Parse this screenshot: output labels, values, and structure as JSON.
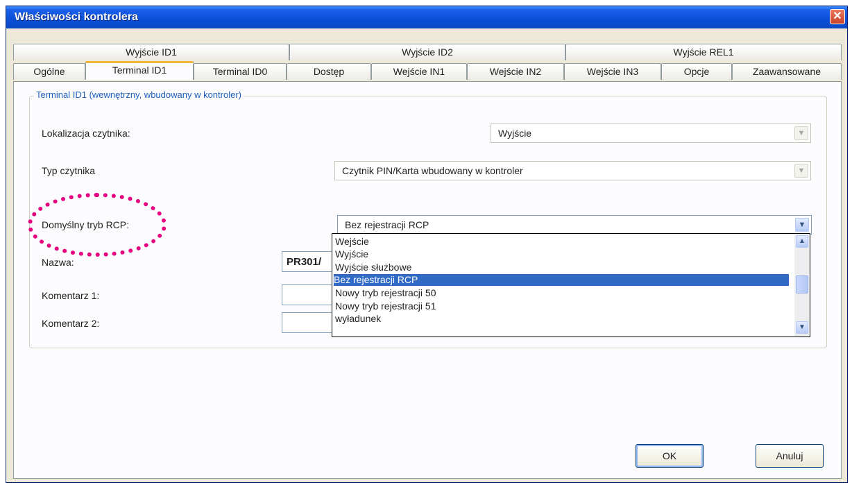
{
  "window": {
    "title": "Właściwości kontrolera",
    "close_symbol": "✕"
  },
  "tabs_top": [
    "Wyjście ID1",
    "Wyjście ID2",
    "Wyjście REL1"
  ],
  "tabs_bottom": [
    "Ogólne",
    "Terminal ID1",
    "Terminal ID0",
    "Dostęp",
    "Wejście IN1",
    "Wejście IN2",
    "Wejście IN3",
    "Opcje",
    "Zaawansowane"
  ],
  "active_tab": "Terminal ID1",
  "group": {
    "legend": "Terminal ID1 (wewnętrzny, wbudowany w kontroler)"
  },
  "fields": {
    "reader_location": {
      "label": "Lokalizacja czytnika:",
      "value": "Wyjście"
    },
    "reader_type": {
      "label": "Typ czytnika",
      "value": "Czytnik PIN/Karta wbudowany w kontroler"
    },
    "rcp_mode": {
      "label": "Domyślny tryb RCP:",
      "value": "Bez rejestracji RCP"
    },
    "name": {
      "label": "Nazwa:",
      "value": "PR301/"
    },
    "comment1": {
      "label": "Komentarz 1:",
      "value": ""
    },
    "comment2": {
      "label": "Komentarz 2:",
      "value": ""
    }
  },
  "dropdown": {
    "options": [
      "Wejście",
      "Wyjście",
      "Wyjście służbowe",
      "Bez rejestracji RCP",
      "Nowy tryb rejestracji 50",
      "Nowy tryb rejestracji 51",
      "wyładunek"
    ],
    "selected": "Bez rejestracji RCP"
  },
  "buttons": {
    "ok": "OK",
    "cancel": "Anuluj"
  },
  "icons": {
    "dropdown_arrow": "▼",
    "scroll_up": "▲",
    "scroll_down": "▼"
  },
  "colors": {
    "titlebar": "#0b4fd6",
    "selection": "#316ac5",
    "annotation": "#e4007f",
    "active_tab_highlight": "#f5b63a"
  }
}
